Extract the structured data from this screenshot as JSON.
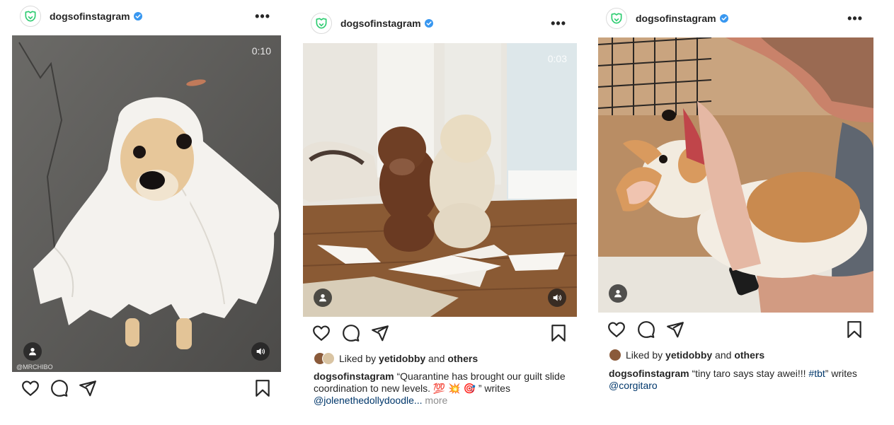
{
  "posts": [
    {
      "username": "dogsofinstagram",
      "more_label": "•••",
      "video_time": "0:10",
      "watermark": "@MRCHIBO",
      "image_alt": "Small dog wearing a paper towel ghost costume on asphalt"
    },
    {
      "username": "dogsofinstagram",
      "more_label": "•••",
      "video_time": "0:03",
      "image_alt": "Two doodle dogs sitting next to shredded toilet paper on a wooden floor",
      "liked_prefix": "Liked by ",
      "liked_user": "yetidobby",
      "liked_and": " and ",
      "liked_others": "others",
      "caption_user": "dogsofinstagram",
      "caption_text": " “Quarantine has brought our guilt slide coordination to new levels. 💯 💥 🎯 ” writes ",
      "caption_mention": "@jolenethedollydoodle...",
      "caption_more": " more"
    },
    {
      "username": "dogsofinstagram",
      "more_label": "•••",
      "image_alt": "Man holding a corgi puppy near a crate",
      "liked_prefix": "Liked by ",
      "liked_user": "yetidobby",
      "liked_and": " and ",
      "liked_others": "others",
      "caption_user": "dogsofinstagram",
      "caption_text": " “tiny taro says stay awei!!! ",
      "caption_hashtag": "#tbt",
      "caption_text2": "” writes ",
      "caption_mention": "@corgitaro"
    }
  ],
  "icons": {
    "profile": "dog-logo-icon",
    "verified": "verified-badge-icon",
    "like": "heart-icon",
    "comment": "comment-icon",
    "share": "paper-plane-icon",
    "save": "bookmark-icon",
    "tag": "user-tag-icon",
    "sound": "speaker-icon"
  },
  "colors": {
    "verified": "#3897f0",
    "link": "#00376b",
    "muted": "#8e8e8e",
    "logo": "#2ecc71"
  }
}
